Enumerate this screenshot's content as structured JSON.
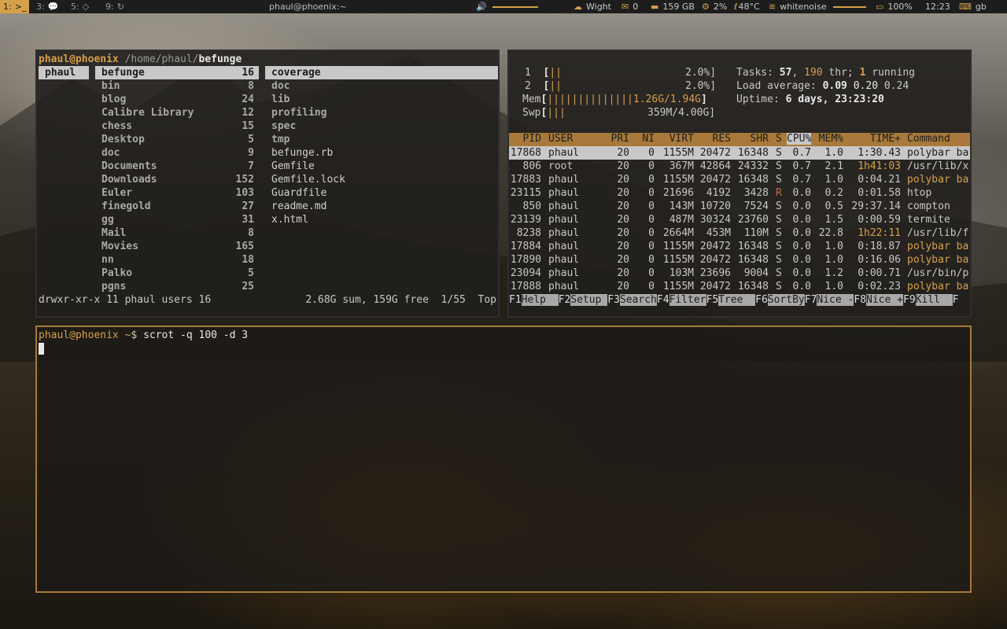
{
  "bar": {
    "workspaces": [
      {
        "label": "1:",
        "icon": ">_",
        "active": true
      },
      {
        "label": "3:",
        "icon": "💬",
        "active": false
      },
      {
        "label": "5:",
        "icon": "◇",
        "active": false
      },
      {
        "label": "9:",
        "icon": "↻",
        "active": false
      }
    ],
    "title": "phaul@phoenix:~",
    "weather": "Wight",
    "mail": "0",
    "disk": "159 GB",
    "cpu": "2%",
    "temp": "48°C",
    "wifi": "whitenoise",
    "battery": "100%",
    "time": "12:23",
    "layout": "gb",
    "accent": "#d6a04a"
  },
  "ranger": {
    "header_user": "phaul@phoenix",
    "header_path": "/home/phaul/",
    "header_dir": "befunge",
    "parent": [
      "phaul"
    ],
    "current": [
      {
        "name": "befunge",
        "count": "16"
      },
      {
        "name": "bin",
        "count": "8"
      },
      {
        "name": "blog",
        "count": "24"
      },
      {
        "name": "Calibre Library",
        "count": "12"
      },
      {
        "name": "chess",
        "count": "15"
      },
      {
        "name": "Desktop",
        "count": "5"
      },
      {
        "name": "doc",
        "count": "9"
      },
      {
        "name": "Documents",
        "count": "7"
      },
      {
        "name": "Downloads",
        "count": "152"
      },
      {
        "name": "Euler",
        "count": "103"
      },
      {
        "name": "finegold",
        "count": "27"
      },
      {
        "name": "gg",
        "count": "31"
      },
      {
        "name": "Mail",
        "count": "8"
      },
      {
        "name": "Movies",
        "count": "165"
      },
      {
        "name": "nn",
        "count": "18"
      },
      {
        "name": "Palko",
        "count": "5"
      },
      {
        "name": "pgns",
        "count": "25"
      }
    ],
    "preview_dirs": [
      "coverage",
      "doc",
      "lib",
      "profiling",
      "spec",
      "tmp"
    ],
    "preview_files": [
      "befunge.rb",
      "Gemfile",
      "Gemfile.lock",
      "Guardfile",
      "readme.md",
      "x.html"
    ],
    "status_left": "drwxr-xr-x 11 phaul users 16",
    "status_right": "2.68G sum, 159G free  1/55  Top"
  },
  "htop": {
    "cpu1": {
      "label": "1",
      "bar": "||",
      "value": "2.0%]"
    },
    "cpu2": {
      "label": "2",
      "bar": "||",
      "value": "2.0%]"
    },
    "mem": {
      "label": "Mem",
      "bar": "||||||||||||||1.2",
      "value_hl": "6G/1.94G",
      "end": "]"
    },
    "swp": {
      "label": "Swp",
      "bar": "|||",
      "value": "359M/4.00G]"
    },
    "tasks_label": "Tasks: ",
    "tasks": "57",
    "thr": "190",
    "thr_label": " thr; ",
    "running": "1",
    "running_label": " running",
    "load_label": "Load average: ",
    "load1": "0.09",
    "load5": "0.20",
    "load15": "0.24",
    "uptime_label": "Uptime: ",
    "uptime": "6 days, 23:23:20",
    "columns": [
      "PID",
      "USER",
      "PRI",
      "NI",
      "VIRT",
      "RES",
      "SHR",
      "S",
      "CPU%",
      "MEM%",
      "TIME+",
      "Command"
    ],
    "rows": [
      [
        "17868",
        "phaul",
        "20",
        "0",
        "1155M",
        "20472",
        "16348",
        "S",
        "0.7",
        "1.0",
        "1:30.43",
        "polybar ba"
      ],
      [
        "806",
        "root",
        "20",
        "0",
        "367M",
        "42864",
        "24332",
        "S",
        "0.7",
        "2.1",
        "1h41:03",
        "/usr/lib/x"
      ],
      [
        "17883",
        "phaul",
        "20",
        "0",
        "1155M",
        "20472",
        "16348",
        "S",
        "0.7",
        "1.0",
        "0:04.21",
        "polybar ba"
      ],
      [
        "23115",
        "phaul",
        "20",
        "0",
        "21696",
        "4192",
        "3428",
        "R",
        "0.0",
        "0.2",
        "0:01.58",
        "htop"
      ],
      [
        "850",
        "phaul",
        "20",
        "0",
        "143M",
        "10720",
        "7524",
        "S",
        "0.0",
        "0.5",
        "29:37.14",
        "compton"
      ],
      [
        "23139",
        "phaul",
        "20",
        "0",
        "487M",
        "30324",
        "23760",
        "S",
        "0.0",
        "1.5",
        "0:00.59",
        "termite"
      ],
      [
        "8238",
        "phaul",
        "20",
        "0",
        "2664M",
        "453M",
        "110M",
        "S",
        "0.0",
        "22.8",
        "1h22:11",
        "/usr/lib/f"
      ],
      [
        "17884",
        "phaul",
        "20",
        "0",
        "1155M",
        "20472",
        "16348",
        "S",
        "0.0",
        "1.0",
        "0:18.87",
        "polybar ba"
      ],
      [
        "17890",
        "phaul",
        "20",
        "0",
        "1155M",
        "20472",
        "16348",
        "S",
        "0.0",
        "1.0",
        "0:16.06",
        "polybar ba"
      ],
      [
        "23094",
        "phaul",
        "20",
        "0",
        "103M",
        "23696",
        "9004",
        "S",
        "0.0",
        "1.2",
        "0:00.71",
        "/usr/bin/p"
      ],
      [
        "17888",
        "phaul",
        "20",
        "0",
        "1155M",
        "20472",
        "16348",
        "S",
        "0.0",
        "1.0",
        "0:02.23",
        "polybar ba"
      ]
    ],
    "fkeys": [
      {
        "key": "F1",
        "label": "Help  "
      },
      {
        "key": "F2",
        "label": "Setup "
      },
      {
        "key": "F3",
        "label": "Search"
      },
      {
        "key": "F4",
        "label": "Filter"
      },
      {
        "key": "F5",
        "label": "Tree  "
      },
      {
        "key": "F6",
        "label": "SortBy"
      },
      {
        "key": "F7",
        "label": "Nice -"
      },
      {
        "key": "F8",
        "label": "Nice +"
      },
      {
        "key": "F9",
        "label": "Kill  "
      },
      {
        "key": "F",
        "label": ""
      }
    ]
  },
  "terminal": {
    "user": "phaul@phoenix",
    "cwd": "~",
    "prompt": "$",
    "command": "scrot -q 100 -d 3"
  }
}
